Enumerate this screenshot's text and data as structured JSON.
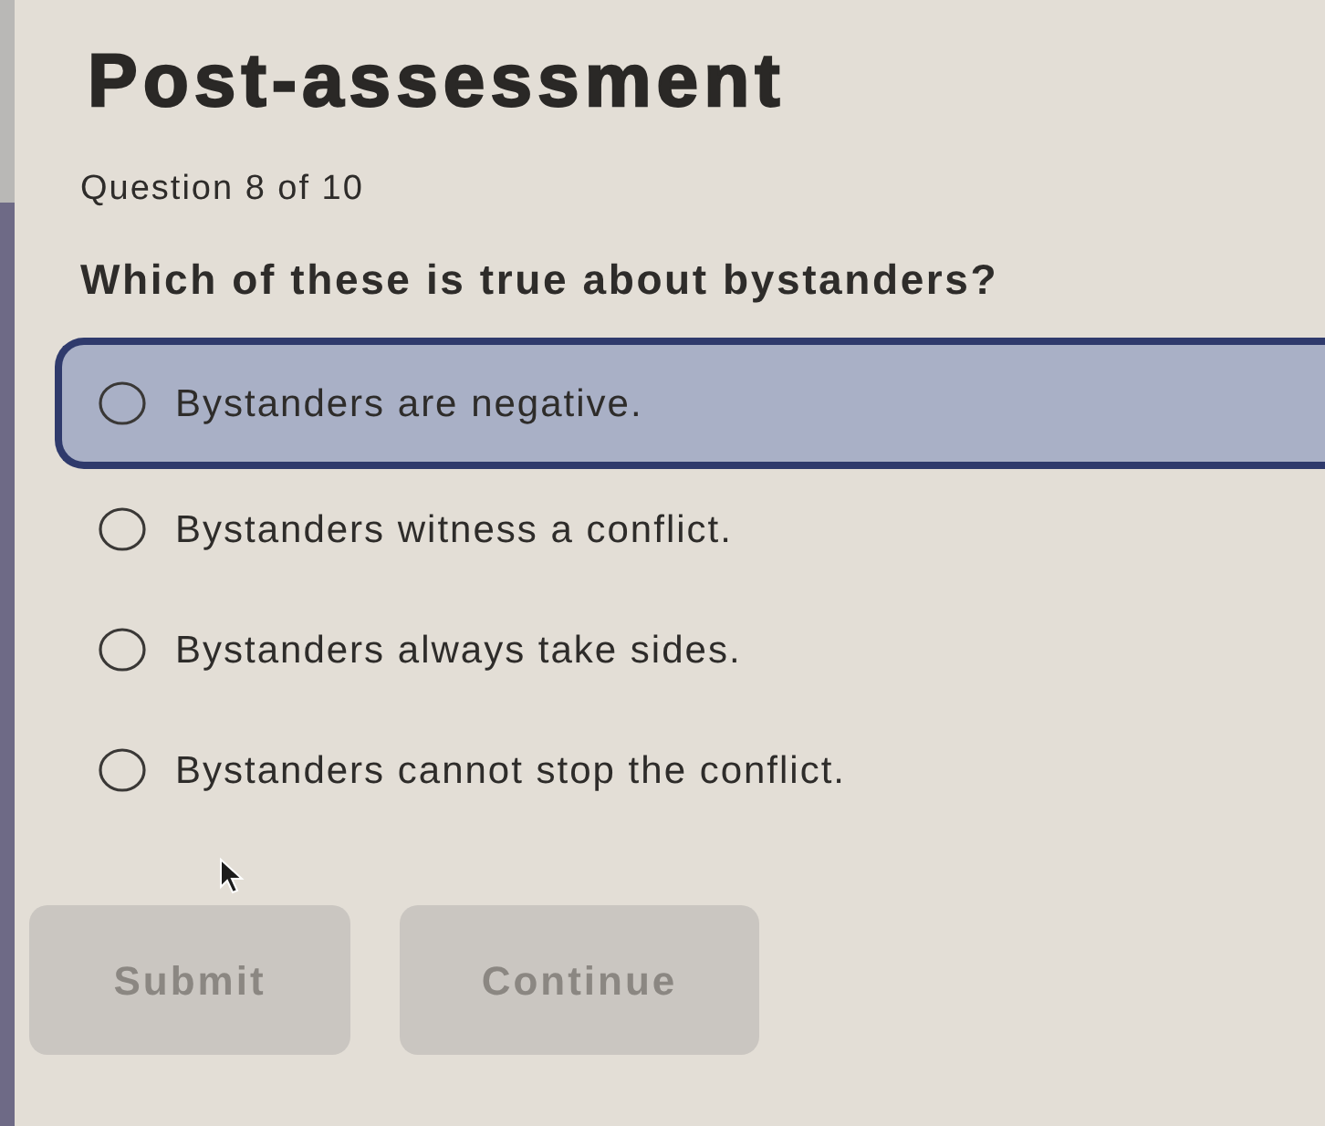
{
  "page": {
    "title": "Post-assessment",
    "progress": "Question 8 of 10"
  },
  "question": {
    "prompt": "Which of these is true about bystanders?",
    "options": [
      {
        "label": "Bystanders are negative.",
        "selected": false,
        "highlighted": true
      },
      {
        "label": "Bystanders witness a conflict.",
        "selected": false,
        "highlighted": false
      },
      {
        "label": "Bystanders always take sides.",
        "selected": false,
        "highlighted": false
      },
      {
        "label": "Bystanders cannot stop the conflict.",
        "selected": false,
        "highlighted": false
      }
    ]
  },
  "buttons": [
    {
      "label": "Submit",
      "disabled": true
    },
    {
      "label": "Continue",
      "disabled": true
    }
  ]
}
